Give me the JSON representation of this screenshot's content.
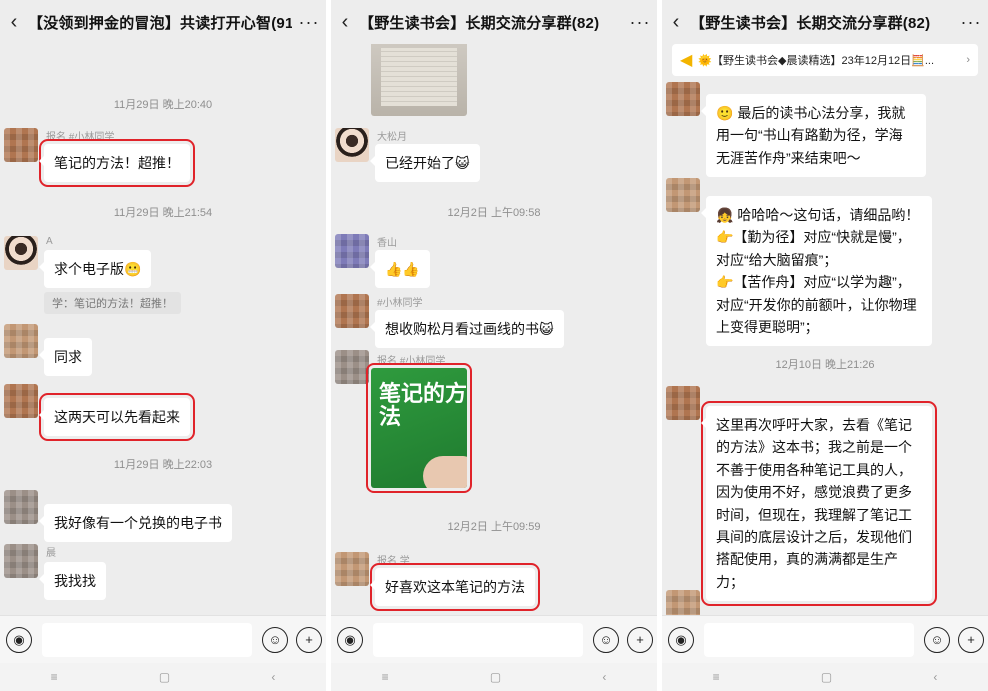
{
  "panels": [
    {
      "title": "【没领到押金的冒泡】共读打开心智(91)",
      "messages": [
        {
          "time": "11月29日 晚上20:40"
        },
        {
          "nick": "报名 #小林同学",
          "text": "笔记的方法！超推！"
        },
        {
          "time": "11月29日 晚上21:54"
        },
        {
          "nick": "A",
          "text": "求个电子版😬"
        },
        {
          "quote": "学：笔记的方法！超推！"
        },
        {
          "nick": "",
          "text": "同求"
        },
        {
          "text": "这两天可以先看起来"
        },
        {
          "time": "11月29日 晚上22:03"
        },
        {
          "text": "我好像有一个兑换的电子书"
        },
        {
          "nick": "晨",
          "text": "我找找"
        }
      ]
    },
    {
      "title": "【野生读书会】长期交流分享群(82)",
      "messages": [
        {
          "nick": "大松月",
          "text": "已经开始了😺"
        },
        {
          "time": "12月2日 上午09:58"
        },
        {
          "nick": "香山",
          "text": "👍👍"
        },
        {
          "nick": "#小林同学",
          "text": "想收购松月看过画线的书😺"
        },
        {
          "nick": "报名 #小林同学",
          "image_title": "笔记的方法"
        },
        {
          "time": "12月2日 上午09:59"
        },
        {
          "nick": "报名 学",
          "text": "好喜欢这本笔记的方法"
        }
      ]
    },
    {
      "title": "【野生读书会】长期交流分享群(82)",
      "banner": "🌞【野生读书会◆晨读精选】23年12月12日🧮...",
      "messages": [
        {
          "text": "🙂 最后的读书心法分享，我就用一句“书山有路勤为径，学海无涯苦作舟”来结束吧～"
        },
        {
          "lines": [
            "👧 哈哈哈～这句话，请细品哟！",
            "👉【勤为径】对应“快就是慢”，对应“给大脑留痕”；",
            "👉【苦作舟】对应“以学为趣”，对应“开发你的前额叶，让你物理上变得更聪明”；"
          ]
        },
        {
          "time": "12月10日 晚上21:26"
        },
        {
          "text": "这里再次呼吁大家，去看《笔记的方法》这本书；我之前是一个不善于使用各种笔记工具的人，因为使用不好，感觉浪费了更多时间，但现在，我理解了笔记工具间的底层设计之后，发现他们搭配使用，真的满满都是生产力；"
        }
      ]
    }
  ],
  "icons": {
    "back": "‹",
    "more": "···",
    "voice": "◉",
    "emoji": "☺",
    "plus": "+"
  },
  "nav": [
    "≡",
    "▢",
    "‹"
  ],
  "colors": {
    "highlight": "#e0232a",
    "bg": "#ededed"
  }
}
